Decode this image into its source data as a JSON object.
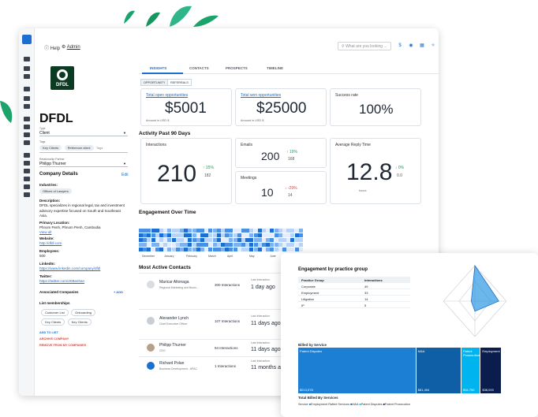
{
  "topbar": {
    "help": "Help",
    "admin": "Admin",
    "search_placeholder": "What are you looking ..."
  },
  "company": {
    "logo_text": "DFDL",
    "name": "DFDL",
    "type_label": "Type",
    "type_value": "Client",
    "tags_label": "Tags",
    "tags": [
      "Key Clients",
      "Reference client"
    ],
    "tags_placeholder": "Tags",
    "partner_label": "Relationship Partner",
    "partner_value": "Philipp Thurner",
    "details_title": "Company Details",
    "edit": "Edit",
    "industries_label": "Industries:",
    "industry": "Offices of Lawyers",
    "description_label": "Description:",
    "description": "DFDL specializes in regional legal, tax and investment advisory expertise focused on South and Southeast Asia.",
    "location_label": "Primary Location:",
    "location": "Phnom Penh, Phnom Penh, Cambodia",
    "view_all": "View all",
    "website_label": "Website:",
    "website": "http://dfdl.com",
    "employees_label": "Employees:",
    "employees": "500",
    "linkedin_label": "LinkedIn:",
    "linkedin": "https://www.linkedin.com/company/dfdl",
    "twitter_label": "Twitter:",
    "twitter": "https://twitter.com/JKBeehan",
    "associated_label": "Associated Companies",
    "add": "+ ADD",
    "lists_label": "List memberships",
    "lists": [
      "Customer List",
      "Onboarding",
      "Key Clients",
      "Key Clients"
    ],
    "add_to_list": "ADD TO LIST",
    "archive": "ARCHIVE COMPANY",
    "remove": "REMOVE FROM MY COMPANIES"
  },
  "tabs": [
    "INSIGHTS",
    "CONTACTS",
    "PROSPECTS",
    "TIMELINE"
  ],
  "subtabs": [
    "OPPORTUNITY",
    "REFERRALS"
  ],
  "stats": {
    "open_title": "Total open opportunities",
    "open_value": "$5001",
    "open_sub": "Amount in USD $",
    "won_title": "Total won opportunities",
    "won_value": "$25000",
    "won_sub": "Amount in USD $",
    "success_title": "Success rate",
    "success_value": "100%"
  },
  "activity": {
    "title": "Activity Past 90 Days",
    "interactions_label": "Interactions",
    "interactions": "210",
    "interactions_delta": "↑ 15%",
    "interactions_prev": "182",
    "emails_label": "Emails",
    "emails": "200",
    "emails_delta": "↑ 19%",
    "emails_prev": "168",
    "meetings_label": "Meetings",
    "meetings": "10",
    "meetings_delta": "↓ -29%",
    "meetings_prev": "14",
    "reply_label": "Average Reply Time",
    "reply": "12.8",
    "reply_delta": "↓ 0%",
    "reply_prev": "0.0",
    "reply_unit": "hours"
  },
  "engagement": {
    "title": "Engagement Over Time",
    "months": [
      "December",
      "January",
      "February",
      "March",
      "April",
      "May",
      "June"
    ]
  },
  "contacts": {
    "title": "Most Active Contacts",
    "interactions_label": "Last Interaction",
    "rows": [
      {
        "name": "Maricar Altonaga",
        "role": "Regional Marketing and Busin...",
        "count": "300 Interactions",
        "last": "1 day ago"
      },
      {
        "name": "Alexander Lynch",
        "role": "Chief Executive Officer",
        "count": "107 Interactions",
        "last": "11 days ago"
      },
      {
        "name": "Philipp Thurner",
        "role": "CEO",
        "count": "94 Interactions",
        "last": "11 days ago"
      },
      {
        "name": "Richard Polan",
        "role": "Business Development - APAC",
        "count": "1 Interactions",
        "last": "11 months ago"
      }
    ]
  },
  "practice": {
    "title": "Engagement by practice group",
    "headers": [
      "Practice Group",
      "Interactions"
    ],
    "rows": [
      [
        "Corporate",
        "49"
      ],
      [
        "Employment",
        "33"
      ],
      [
        "Litigation",
        "14"
      ],
      [
        "IP",
        "5"
      ]
    ],
    "billed_title": "Billed by Service",
    "tiles": [
      "Patent Disputes",
      "M&A",
      "Patent Prosecution",
      "Employment"
    ],
    "tile_values": [
      "$213,578",
      "$81,494",
      "$34,750",
      "$38,000"
    ],
    "total_title": "Total Billed By Services",
    "legend_label": "Service",
    "legend": [
      "Employment Rafted Services",
      "M&A",
      "Patent Disputes",
      "Patent Prosecution"
    ],
    "colors": [
      "#1c7fd3",
      "#0e5fa6",
      "#00b4f0",
      "#0b1d4d"
    ]
  }
}
